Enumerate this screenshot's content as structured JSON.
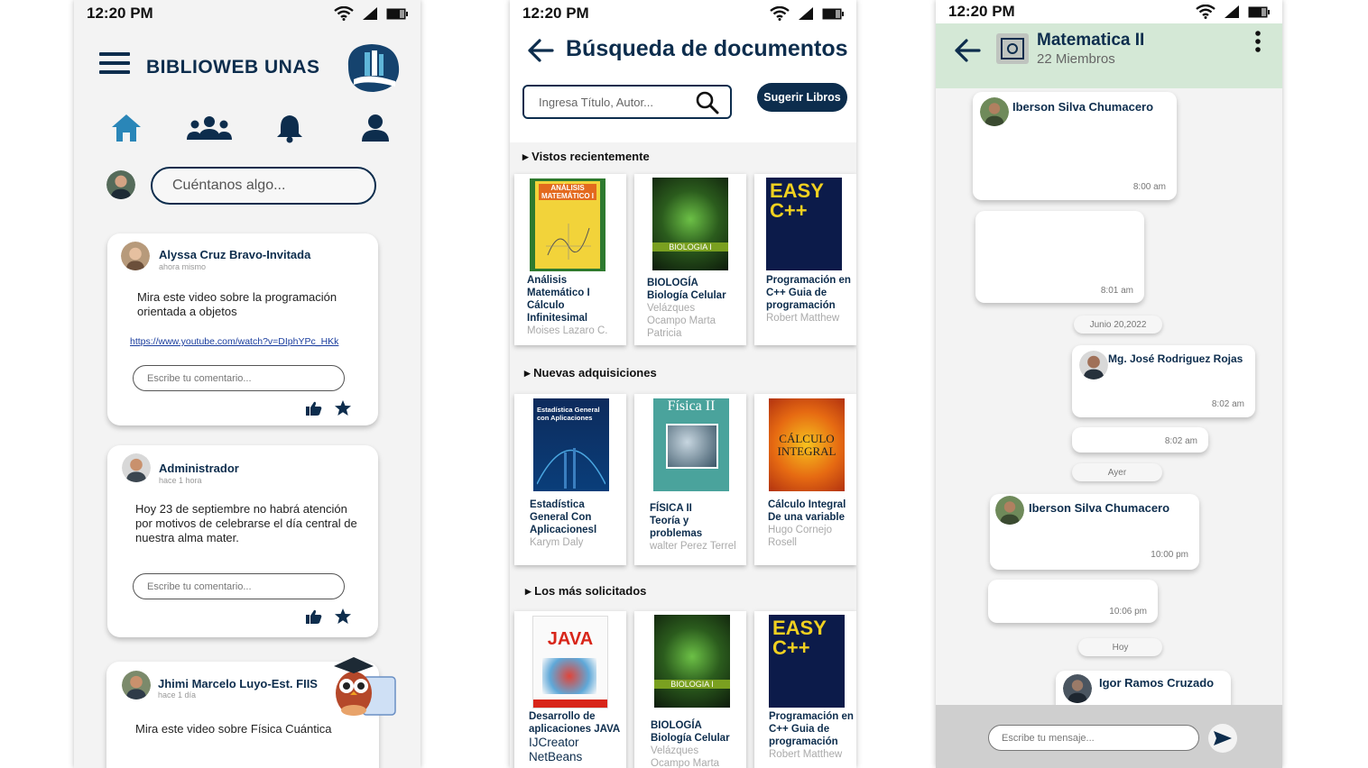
{
  "status_time": "12:20 PM",
  "feed": {
    "brand": "BIBLIOWEB UNAS",
    "compose_placeholder": "Cuéntanos algo...",
    "posts": [
      {
        "author": "Alyssa Cruz Bravo-Invitada",
        "time": "ahora mismo",
        "text": "Mira este video sobre la programación orientada a objetos",
        "link": "https://www.youtube.com/watch?v=DIphYPc_HKk",
        "comment_placeholder": "Escribe tu comentario..."
      },
      {
        "author": "Administrador",
        "time": "hace 1 hora",
        "text": "Hoy 23 de septiembre no habrá atención por motivos de celebrarse el día central de nuestra alma mater.",
        "comment_placeholder": "Escribe tu comentario..."
      },
      {
        "author": "Jhimi Marcelo Luyo-Est. FIIS",
        "time": "hace 1 día",
        "text": "Mira este video sobre Física Cuántica"
      }
    ]
  },
  "search": {
    "title": "Búsqueda de documentos",
    "placeholder": "Ingresa Título, Autor...",
    "suggest_label": "Sugerir Libros",
    "sections": [
      {
        "label": "Vistos recientemente",
        "books": [
          {
            "cover_text": "ANÁLISIS MATEMÁTICO I",
            "title": "Análisis Matemático I Cálculo Infinitesimal",
            "author": "Moises Lazaro C."
          },
          {
            "cover_text": "BIOLOGIA I",
            "title": "BIOLOGÍA Biología Celular",
            "author": "Velázques Ocampo Marta Patricia"
          },
          {
            "cover_text": "EASY C++",
            "title": "Programación en C++ Guia de programación",
            "author": "Robert Matthew"
          }
        ]
      },
      {
        "label": "Nuevas adquisiciones",
        "books": [
          {
            "cover_text": "Estadística General con Aplicaciones",
            "title": "Estadística General Con Aplicacionesl",
            "author": "Karym Daly"
          },
          {
            "cover_text": "Física II",
            "title": "FÍSICA II Teoría y problemas",
            "author": "walter Perez Terrel"
          },
          {
            "cover_text": "CÁLCULO INTEGRAL",
            "title": "Cálculo Integral De una variable",
            "author": "Hugo Cornejo Rosell"
          }
        ]
      },
      {
        "label": "Los más solicitados",
        "books": [
          {
            "cover_text": "JAVA",
            "title": "Desarrollo de aplicaciones JAVA",
            "subtitle": "IJCreator NetBeans"
          },
          {
            "cover_text": "BIOLOGIA I",
            "title": "BIOLOGÍA Biología Celular",
            "author": "Velázques Ocampo Marta"
          },
          {
            "cover_text": "EASY C++",
            "title": "Programación en C++ Guia de programación",
            "author": "Robert Matthew"
          }
        ]
      }
    ]
  },
  "chat": {
    "group_name": "Matematica II",
    "members": "22 Miembros",
    "messages": [
      {
        "sender": "Iberson Silva Chumacero",
        "time": "8:00 am"
      },
      {
        "time": "8:01 am"
      },
      {
        "sender": "Mg. José Rodriguez Rojas",
        "time": "8:02 am"
      },
      {
        "time": "8:02 am"
      },
      {
        "sender": "Iberson Silva Chumacero",
        "time": "10:00 pm"
      },
      {
        "time": "10:06 pm"
      },
      {
        "sender": "Igor Ramos Cruzado"
      }
    ],
    "date_labels": [
      "Junio 20,2022",
      "Ayer",
      "Hoy"
    ],
    "input_placeholder": "Escribe tu mensaje..."
  }
}
